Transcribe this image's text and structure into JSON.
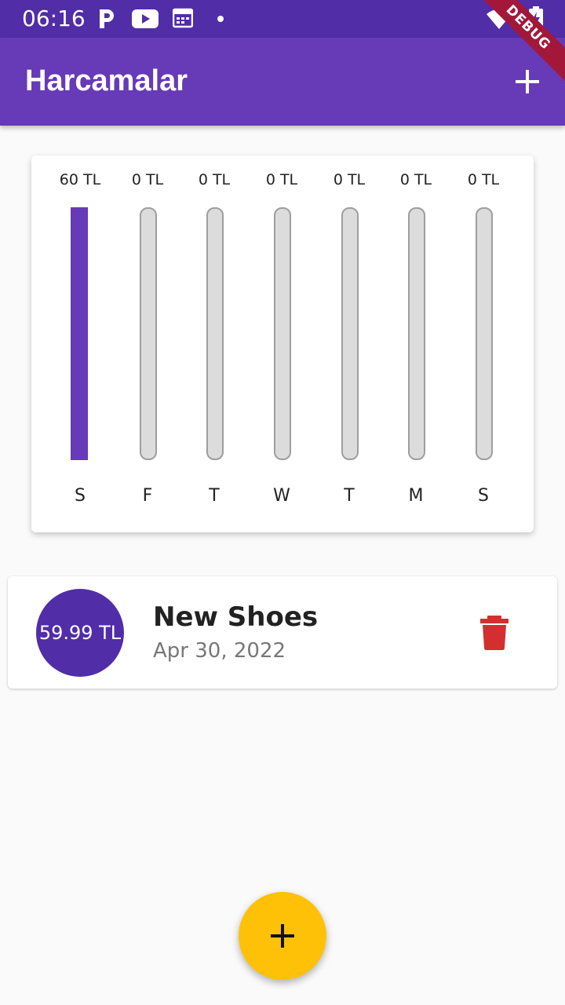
{
  "status_bar": {
    "time": "06:16",
    "icons": [
      "parking-icon",
      "youtube-icon",
      "calendar-icon",
      "notification-dot-icon",
      "wifi-icon",
      "battery-charging-icon"
    ]
  },
  "debug_banner": "DEBUG",
  "app_bar": {
    "title": "Harcamalar",
    "action_icon": "add-icon"
  },
  "chart_data": {
    "type": "bar",
    "categories": [
      "S",
      "F",
      "T",
      "W",
      "T",
      "M",
      "S"
    ],
    "value_labels": [
      "60 TL",
      "0 TL",
      "0 TL",
      "0 TL",
      "0 TL",
      "0 TL",
      "0 TL"
    ],
    "values": [
      60,
      0,
      0,
      0,
      0,
      0,
      0
    ],
    "fill_fraction": [
      1,
      0,
      0,
      0,
      0,
      0,
      0
    ],
    "fill_color": "#673ab7",
    "track_color": "#dcdcdc"
  },
  "transactions": [
    {
      "amount": "59.99 TL",
      "title": "New Shoes",
      "date": "Apr 30, 2022",
      "delete_icon": "trash-icon"
    }
  ],
  "fab": {
    "icon": "add-icon"
  },
  "colors": {
    "primary": "#673ab7",
    "primary_dark": "#512da8",
    "accent": "#ffc107",
    "delete": "#d32f2f"
  }
}
